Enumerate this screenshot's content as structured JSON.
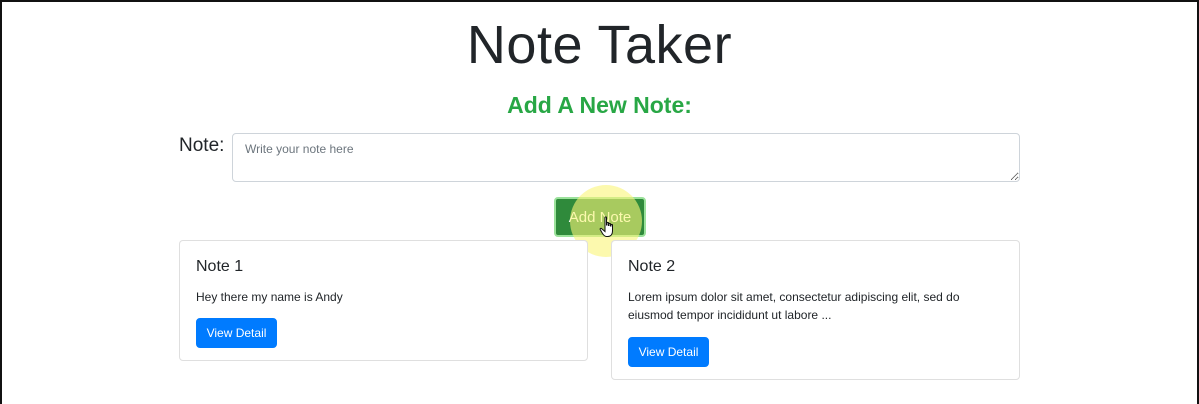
{
  "header": {
    "title": "Note Taker",
    "subtitle": "Add A New Note:"
  },
  "form": {
    "note_label": "Note:",
    "note_placeholder": "Write your note here",
    "note_value": "",
    "submit_label": "Add Note"
  },
  "notes": [
    {
      "title": "Note 1",
      "body": "Hey there my name is Andy",
      "button_label": "View Detail"
    },
    {
      "title": "Note 2",
      "body": "Lorem ipsum dolor sit amet, consectetur adipiscing elit, sed do eiusmod tempor incididunt ut labore ...",
      "button_label": "View Detail"
    }
  ],
  "colors": {
    "accent_green": "#28a745",
    "button_blue": "#007bff",
    "cursor_highlight": "#faf578"
  },
  "icons": {
    "cursor": "hand-pointer-icon"
  }
}
